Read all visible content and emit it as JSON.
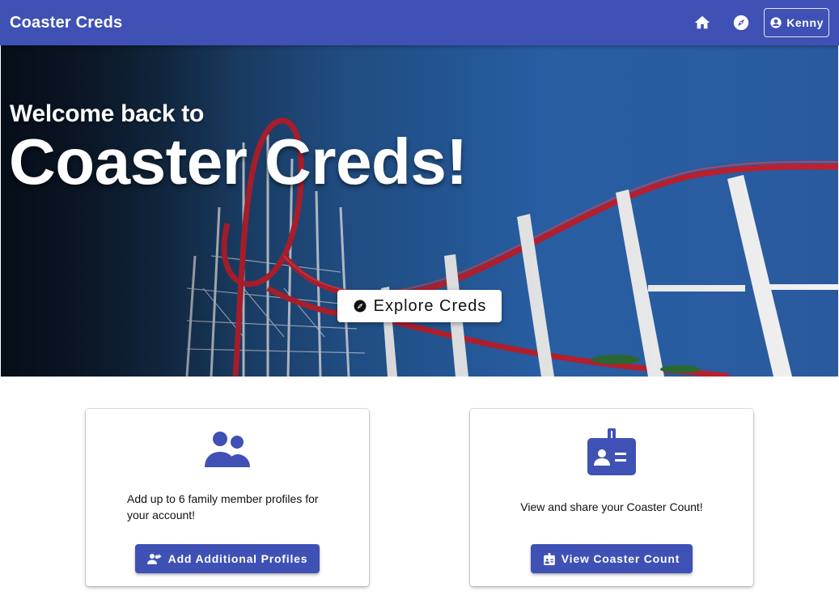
{
  "appbar": {
    "title": "Coaster Creds",
    "home_icon": "home-icon",
    "explore_icon": "compass-icon",
    "user_label": "Kenny",
    "user_icon": "account-circle-icon"
  },
  "hero": {
    "subtitle": "Welcome back to",
    "title": "Coaster Creds!",
    "explore_label": "Explore Creds",
    "explore_icon": "compass-icon"
  },
  "cards": [
    {
      "icon": "people-icon",
      "text": "Add up to 6 family member profiles for your account!",
      "button_label": "Add Additional Profiles",
      "button_icon": "add-person-icon"
    },
    {
      "icon": "badge-icon",
      "text": "View and share your Coaster Count!",
      "button_label": "View Coaster Count",
      "button_icon": "badge-icon"
    }
  ],
  "colors": {
    "primary": "#3f51b5",
    "track": "#c0202e",
    "supports": "#f2f2f2"
  }
}
